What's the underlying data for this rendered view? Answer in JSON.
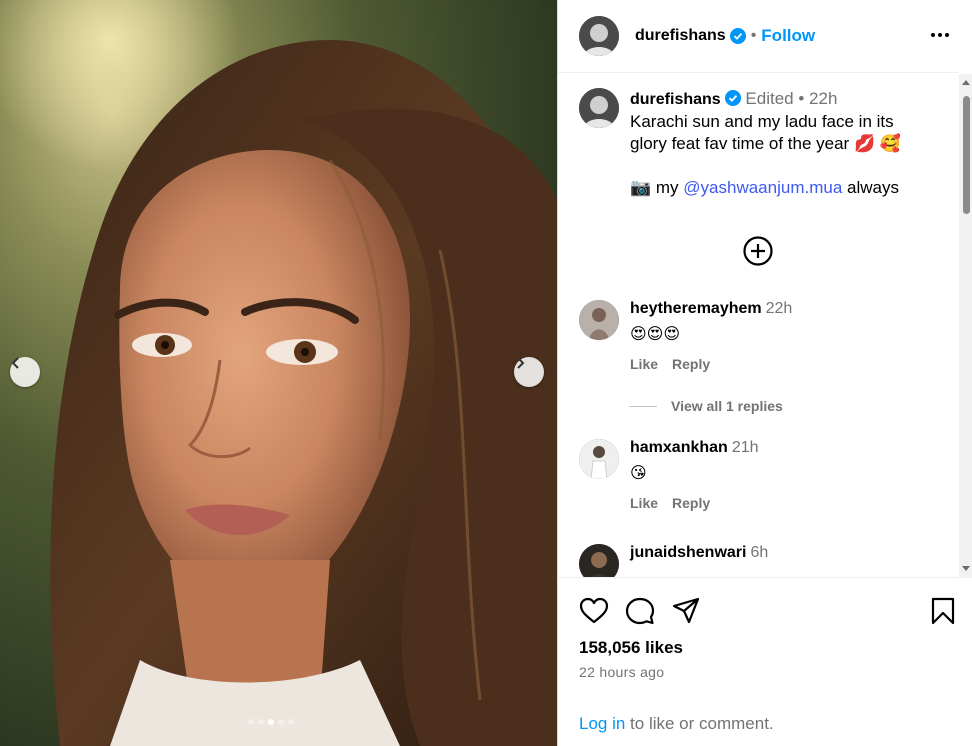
{
  "post": {
    "username": "durefishans",
    "follow_label": "Follow",
    "separator": "•",
    "caption_meta": "Edited •",
    "caption_time": "22h",
    "caption_line1": "Karachi sun and my ladu face in its",
    "caption_line2": "glory feat fav time of the year 💋 🥰",
    "caption_line3_prefix": "📷 my ",
    "caption_mention": "@yashwaanjum.mua",
    "caption_line3_suffix": " always",
    "likes": "158,056 likes",
    "time_ago": "22 hours ago"
  },
  "carousel": {
    "slide_count": 5,
    "active_index": 2
  },
  "comments": [
    {
      "username": "heytheremayhem",
      "time": "22h",
      "text": "😍😍😍",
      "like_label": "Like",
      "reply_label": "Reply"
    },
    {
      "username": "hamxankhan",
      "time": "21h",
      "text": "😘",
      "like_label": "Like",
      "reply_label": "Reply"
    },
    {
      "username": "junaidshenwari",
      "time": "6h",
      "text": ""
    }
  ],
  "view_replies": "View all 1 replies",
  "login_prompt": {
    "link": "Log in",
    "rest": " to like or comment."
  },
  "colors": {
    "accent": "#0095f6",
    "mention": "#3d5af1",
    "muted": "#737373",
    "verified": "#0095f6"
  }
}
